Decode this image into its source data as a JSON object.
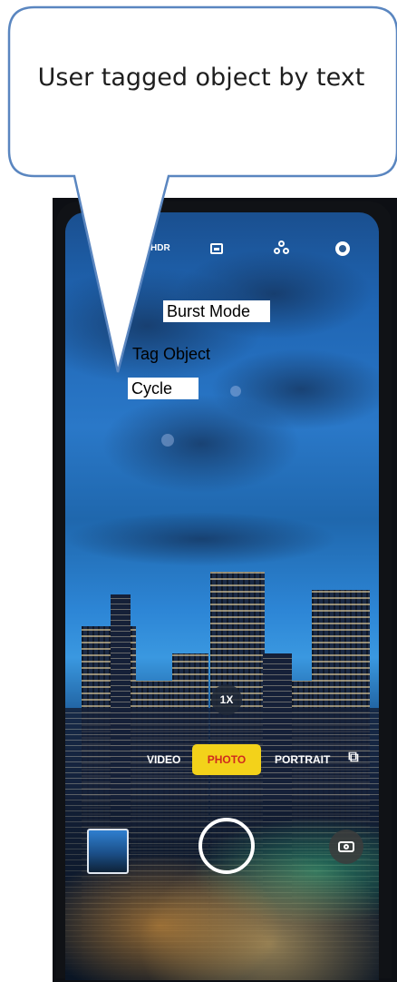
{
  "callout": {
    "text": "User tagged object by text"
  },
  "camera": {
    "top_bar": {
      "hdr_label": "HDR",
      "icons": [
        "hdr-icon",
        "aspect-ratio-icon",
        "filter-icon",
        "settings-icon"
      ]
    },
    "tags": {
      "burst_mode": "Burst Mode",
      "tag_object": "Tag Object",
      "cycle": "Cycle"
    },
    "zoom_label": "1X",
    "modes": {
      "video": "VIDEO",
      "photo": "PHOTO",
      "portrait": "PORTRAIT",
      "active": "PHOTO"
    },
    "more_modes_icon": "more-modes-icon",
    "colors": {
      "active_mode_bg": "#f3d21a",
      "active_mode_text": "#d02a1e",
      "label_bg": "#ffffff"
    }
  }
}
